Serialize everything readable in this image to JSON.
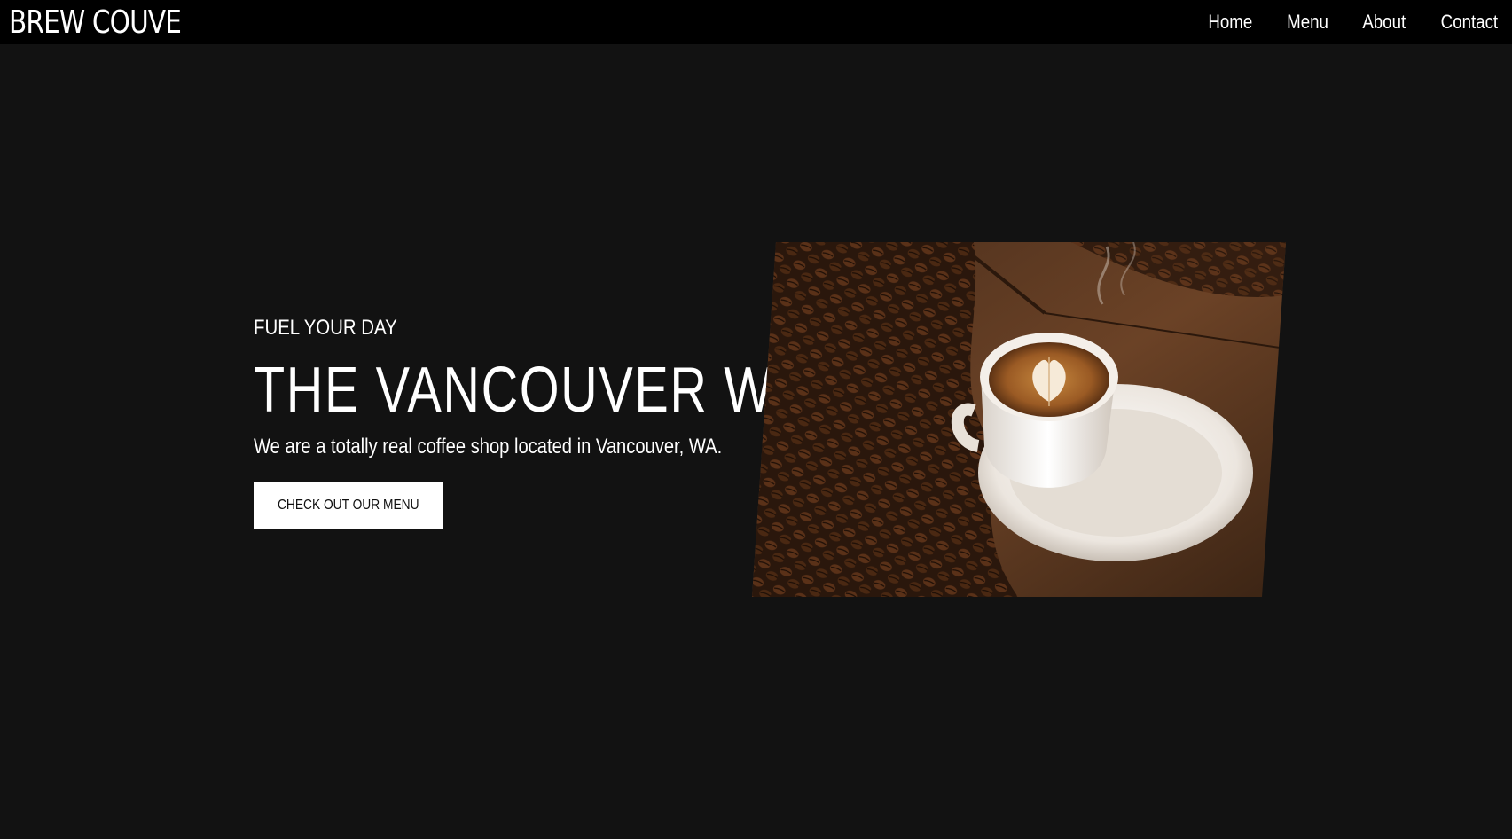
{
  "header": {
    "brand": "BREW COUVE",
    "nav": [
      {
        "label": "Home"
      },
      {
        "label": "Menu"
      },
      {
        "label": "About"
      },
      {
        "label": "Contact"
      }
    ]
  },
  "hero": {
    "eyebrow": "FUEL YOUR DAY",
    "headline": "THE VANCOUVER WAY",
    "subline": "We are a totally real coffee shop located in Vancouver, WA.",
    "cta_label": "CHECK OUT OUR MENU",
    "image_subject": "latte-cup-on-coffee-beans"
  },
  "colors": {
    "page_background": "#121212",
    "header_background": "#000000",
    "text": "#ffffff",
    "cta_background": "#ffffff",
    "cta_text": "#111111"
  }
}
